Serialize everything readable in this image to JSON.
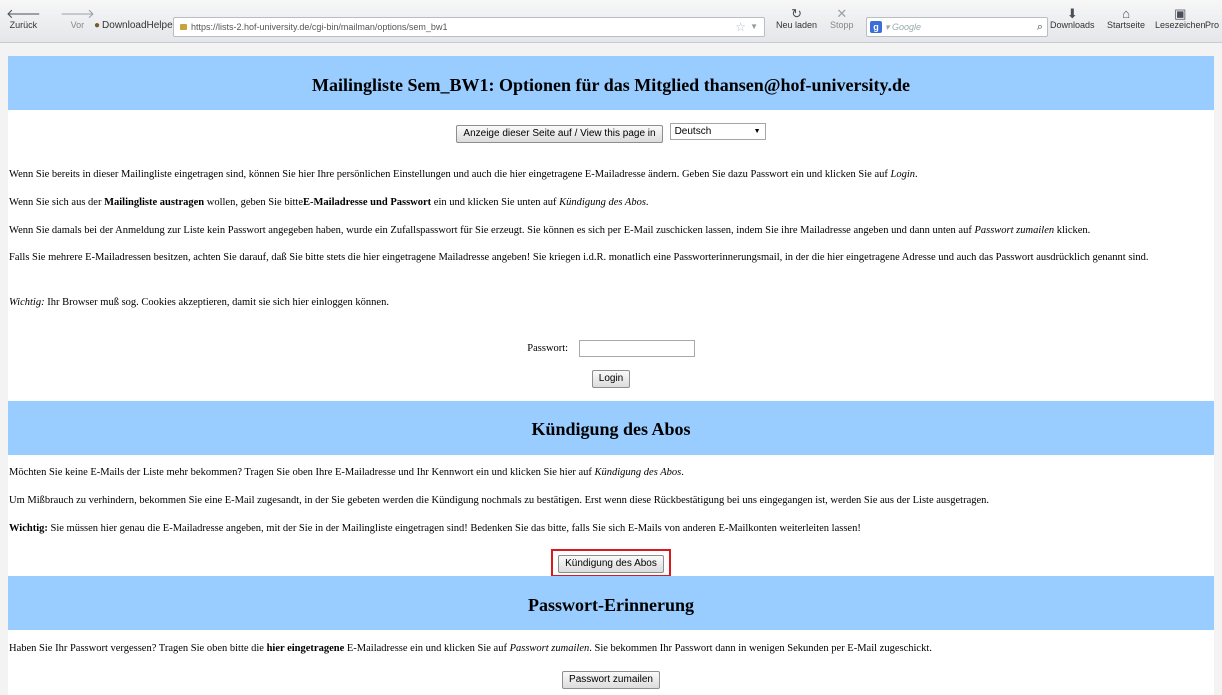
{
  "browser": {
    "back_label": "Zurück",
    "forward_label": "Vor",
    "downloadhelper_label": "DownloadHelper",
    "url": "https://lists-2.hof-university.de/cgi-bin/mailman/options/sem_bw1",
    "reload_label": "Neu laden",
    "stop_label": "Stopp",
    "search_placeholder": "Google",
    "downloads_label": "Downloads",
    "home_label": "Startseite",
    "bookmarks_label": "Lesezeichen",
    "profile_label": "Pro"
  },
  "header": {
    "title": "Mailingliste Sem_BW1: Optionen für das Mitglied thansen@hof-university.de"
  },
  "language": {
    "button_label": "Anzeige dieser Seite auf / View this page in",
    "selected": "Deutsch"
  },
  "intro": {
    "p1": "Wenn Sie bereits in dieser Mailingliste eingetragen sind, können Sie hier Ihre persönlichen Einstellungen und auch die hier eingetragene E-Mailadresse ändern. Geben Sie dazu Passwort ein und klicken Sie auf ",
    "p1_em": "Login",
    "p1_end": ".",
    "p2_a": "Wenn Sie sich aus der ",
    "p2_b": "Mailingliste austragen",
    "p2_c": " wollen, geben Sie bitte",
    "p2_d": "E-Mailadresse und Passwort",
    "p2_e": " ein und klicken Sie unten auf ",
    "p2_f": "Kündigung des Abos",
    "p2_g": ".",
    "p3_a": "Wenn Sie damals bei der Anmeldung zur Liste kein Passwort angegeben haben, wurde ein Zufallspasswort für Sie erzeugt. Sie können es sich per E-Mail zuschicken lassen, indem Sie ihre Mailadresse angeben und dann unten auf ",
    "p3_b": "Passwort zumailen",
    "p3_c": " klicken.",
    "p4": "Falls Sie mehrere E-Mailadressen besitzen, achten Sie darauf, daß Sie bitte stets die hier eingetragene Mailadresse angeben! Sie kriegen i.d.R. monatlich eine Passworterinnerungsmail, in der die hier eingetragene Adresse und auch das Passwort ausdrücklich genannt sind.",
    "p5_a": "Wichtig:",
    "p5_b": " Ihr Browser muß sog. Cookies akzeptieren, damit sie sich hier einloggen können."
  },
  "login": {
    "password_label": "Passwort:",
    "password_value": "",
    "button_label": "Login"
  },
  "unsubscribe": {
    "title": "Kündigung des Abos",
    "p1_a": "Möchten Sie keine E-Mails der Liste mehr bekommen? Tragen Sie oben Ihre E-Mailadresse und Ihr Kennwort ein und klicken Sie hier auf ",
    "p1_b": "Kündigung des Abos",
    "p1_c": ".",
    "p2": "Um Mißbrauch zu verhindern, bekommen Sie eine E-Mail zugesandt, in der Sie gebeten werden die Kündigung nochmals zu bestätigen. Erst wenn diese Rückbestätigung bei uns eingegangen ist, werden Sie aus der Liste ausgetragen.",
    "p3_a": "Wichtig:",
    "p3_b": " Sie müssen hier genau die E-Mailadresse angeben, mit der Sie in der Mailingliste eingetragen sind! Bedenken Sie das bitte, falls Sie sich E-Mails von anderen E-Mailkonten weiterleiten lassen!",
    "button_label": "Kündigung des Abos"
  },
  "reminder": {
    "title": "Passwort-Erinnerung",
    "p1_a": "Haben Sie Ihr Passwort vergessen? Tragen Sie oben bitte die ",
    "p1_b": "hier eingetragene",
    "p1_c": " E-Mailadresse ein und klicken Sie auf ",
    "p1_d": "Passwort zumailen",
    "p1_e": ". Sie bekommen Ihr Passwort dann in wenigen Sekunden per E-Mail zugeschickt.",
    "button_label": "Passwort zumailen"
  },
  "colors": {
    "banner": "#99ccff",
    "highlight_border": "#d9191f"
  }
}
